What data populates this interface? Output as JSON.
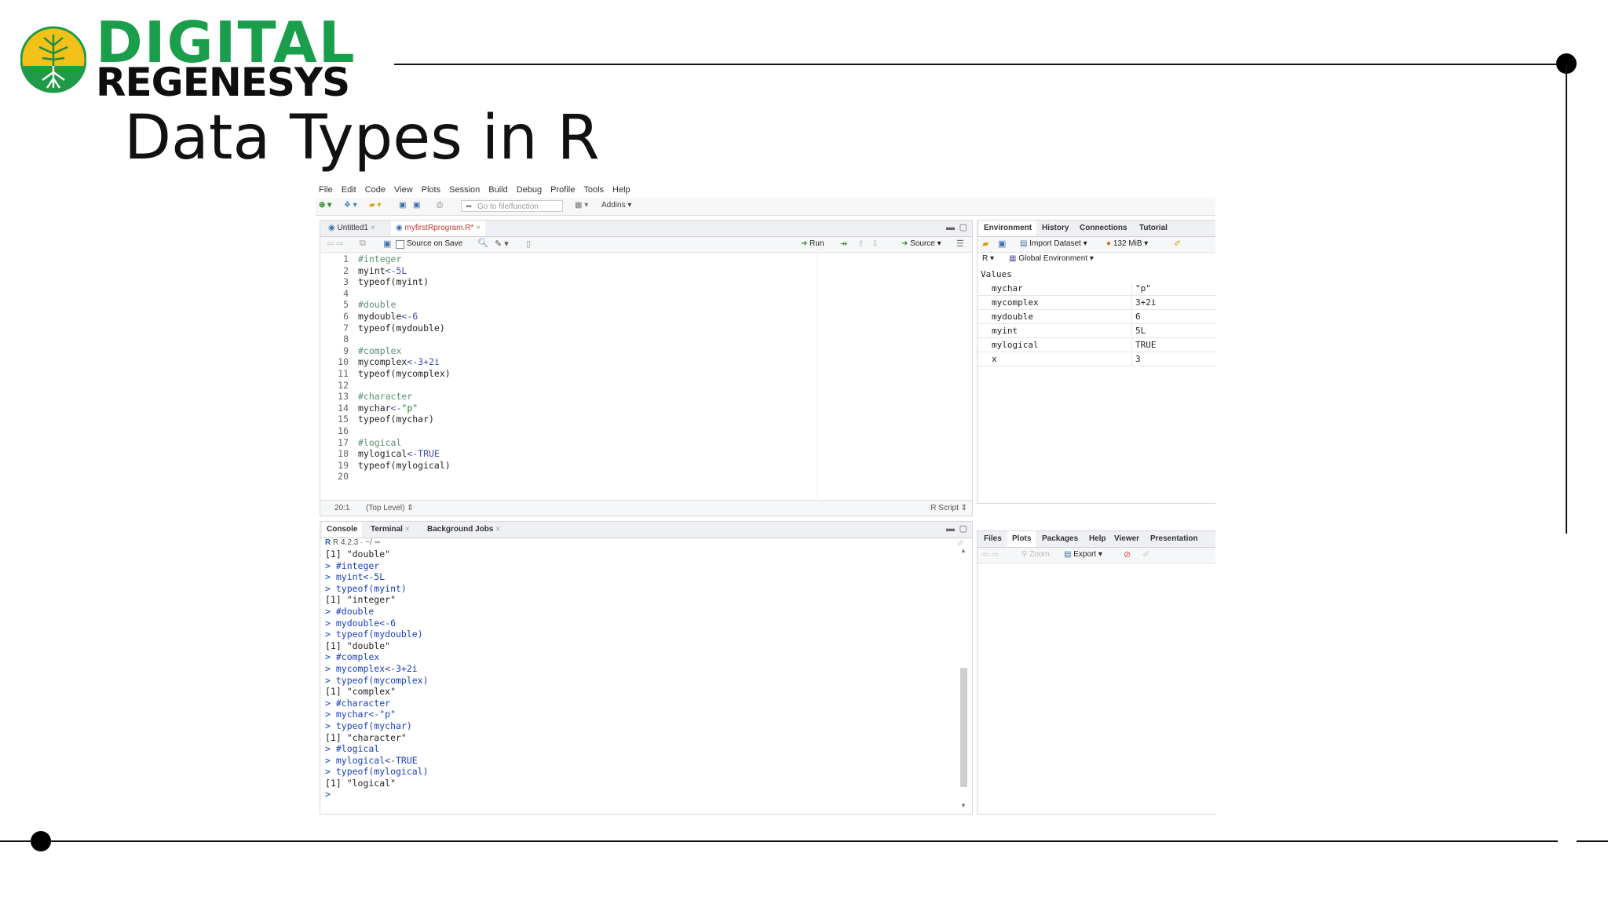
{
  "logo": {
    "line1": "DIGITAL",
    "line2": "REGENESYS"
  },
  "slide": {
    "title": "Data Types in R"
  },
  "menu": [
    "File",
    "Edit",
    "Code",
    "View",
    "Plots",
    "Session",
    "Build",
    "Debug",
    "Profile",
    "Tools",
    "Help"
  ],
  "toolbar": {
    "goto_placeholder": "Go to file/function",
    "addins": "Addins"
  },
  "editor": {
    "tabs": [
      "Untitled1",
      "myfirstRprogram.R*"
    ],
    "source_on_save": "Source on Save",
    "run": "Run",
    "source": "Source",
    "line_numbers": [
      "1",
      "2",
      "3",
      "4",
      "5",
      "6",
      "7",
      "8",
      "9",
      "10",
      "11",
      "12",
      "13",
      "14",
      "15",
      "16",
      "17",
      "18",
      "19",
      "20"
    ],
    "lines": [
      "#integer",
      "myint<-5L",
      "typeof(myint)",
      "",
      "#double",
      "mydouble<-6",
      "typeof(mydouble)",
      "",
      "#complex",
      "mycomplex<-3+2i",
      "typeof(mycomplex)",
      "",
      "#character",
      "mychar<-\"p\"",
      "typeof(mychar)",
      "",
      "#logical",
      "mylogical<-TRUE",
      "typeof(mylogical)",
      ""
    ],
    "status_pos": "20:1",
    "status_scope": "(Top Level) ⇕",
    "status_type": "R Script ⇕"
  },
  "console": {
    "tabs": [
      "Console",
      "Terminal",
      "Background Jobs"
    ],
    "version": "R 4.2.3 · ~/",
    "lines": [
      {
        "t": "out",
        "s": "[1] \"double\""
      },
      {
        "t": "in",
        "s": "> #integer"
      },
      {
        "t": "in",
        "s": "> myint<-5L"
      },
      {
        "t": "in",
        "s": "> typeof(myint)"
      },
      {
        "t": "out",
        "s": "[1] \"integer\""
      },
      {
        "t": "in",
        "s": "> #double"
      },
      {
        "t": "in",
        "s": "> mydouble<-6"
      },
      {
        "t": "in",
        "s": "> typeof(mydouble)"
      },
      {
        "t": "out",
        "s": "[1] \"double\""
      },
      {
        "t": "in",
        "s": "> #complex"
      },
      {
        "t": "in",
        "s": "> mycomplex<-3+2i"
      },
      {
        "t": "in",
        "s": "> typeof(mycomplex)"
      },
      {
        "t": "out",
        "s": "[1] \"complex\""
      },
      {
        "t": "in",
        "s": "> #character"
      },
      {
        "t": "in",
        "s": "> mychar<-\"p\""
      },
      {
        "t": "in",
        "s": "> typeof(mychar)"
      },
      {
        "t": "out",
        "s": "[1] \"character\""
      },
      {
        "t": "in",
        "s": "> #logical"
      },
      {
        "t": "in",
        "s": "> mylogical<-TRUE"
      },
      {
        "t": "in",
        "s": "> typeof(mylogical)"
      },
      {
        "t": "out",
        "s": "[1] \"logical\""
      },
      {
        "t": "in",
        "s": "> "
      }
    ]
  },
  "environment": {
    "tabs": [
      "Environment",
      "History",
      "Connections",
      "Tutorial"
    ],
    "import_dataset": "Import Dataset",
    "memory": "132 MiB",
    "lang": "R",
    "scope": "Global Environment",
    "section": "Values",
    "rows": [
      {
        "name": "mychar",
        "value": "\"p\""
      },
      {
        "name": "mycomplex",
        "value": "3+2i"
      },
      {
        "name": "mydouble",
        "value": "6"
      },
      {
        "name": "myint",
        "value": "5L"
      },
      {
        "name": "mylogical",
        "value": "TRUE"
      },
      {
        "name": "x",
        "value": "3"
      }
    ]
  },
  "files": {
    "tabs": [
      "Files",
      "Plots",
      "Packages",
      "Help",
      "Viewer",
      "Presentation"
    ],
    "zoom": "Zoom",
    "export": "Export"
  }
}
